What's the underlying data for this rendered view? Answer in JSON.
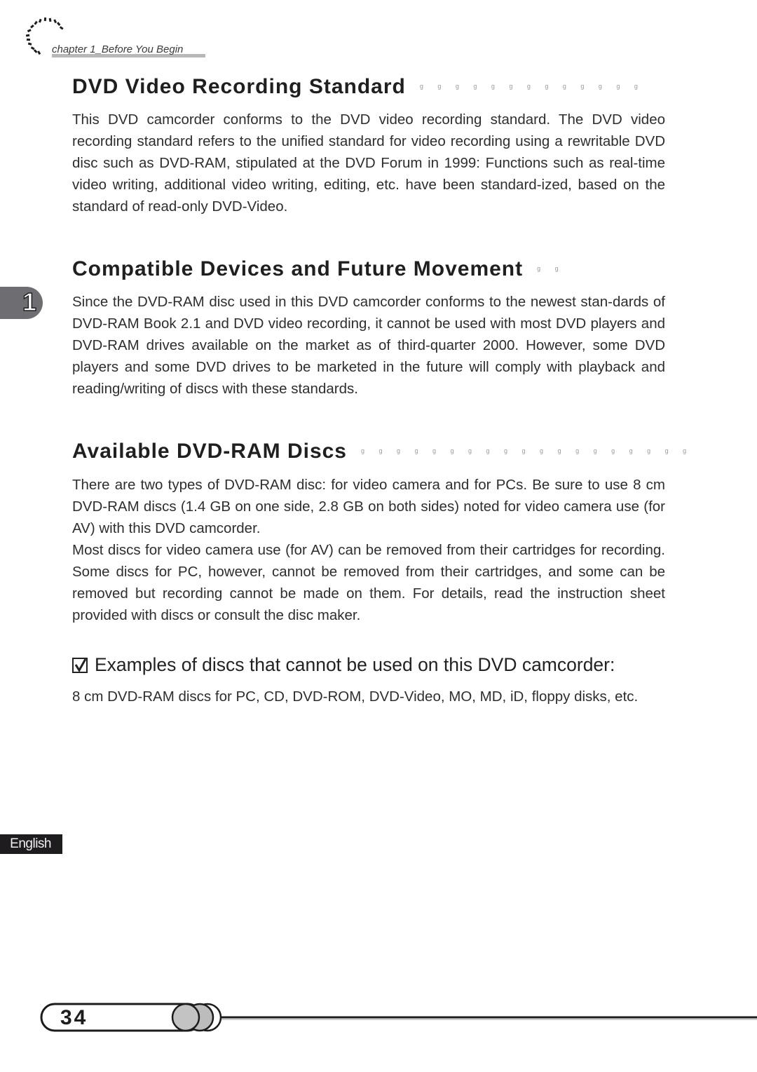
{
  "header": {
    "chapter_label": "chapter 1_Before You Begin",
    "icon": "dotted-arc-icon"
  },
  "chapter_tab": {
    "number": "1"
  },
  "sections": [
    {
      "title": "DVD Video Recording Standard",
      "dots": "g g g g g g g g g g g g g",
      "paragraphs": [
        "This DVD camcorder conforms to the DVD video recording standard. The DVD video recording standard refers to the unified standard for video recording using a rewritable DVD disc such as DVD-RAM, stipulated at the DVD Forum in 1999: Functions such as real-time video writing, additional video writing, editing, etc. have been standard-ized, based on the standard of read-only DVD-Video."
      ]
    },
    {
      "title": "Compatible Devices and Future Movement",
      "dots": "g g",
      "paragraphs": [
        "Since the DVD-RAM disc used in this DVD camcorder conforms to the newest stan-dards of DVD-RAM Book 2.1 and DVD video recording, it cannot be used with most DVD players and DVD-RAM drives available on the market as of third-quarter 2000. However, some DVD players and some DVD drives to be marketed in the future will comply with playback and reading/writing of discs with these standards."
      ]
    },
    {
      "title": "Available DVD-RAM Discs",
      "dots": "g g g g g g g g g g g g g g g g g g g",
      "paragraphs": [
        "There are two types of DVD-RAM disc: for video camera and for PCs. Be sure to use 8 cm DVD-RAM discs (1.4 GB on one side, 2.8 GB on both sides) noted for video camera use (for AV) with this DVD camcorder.",
        "Most discs for video camera use (for AV) can be removed from their cartridges for recording. Some discs for PC, however, cannot be removed from their cartridges, and some can be removed but recording cannot be made on them. For details, read the instruction sheet provided with discs or consult the disc maker."
      ]
    }
  ],
  "note": {
    "icon": "checkbox-checked-icon",
    "title": "Examples of discs that cannot be used on this DVD camcorder:",
    "text": "8 cm DVD-RAM discs for PC, CD, DVD-ROM, DVD-Video, MO, MD, iD, floppy disks, etc."
  },
  "language_badge": "English",
  "footer": {
    "page_number": "34"
  }
}
